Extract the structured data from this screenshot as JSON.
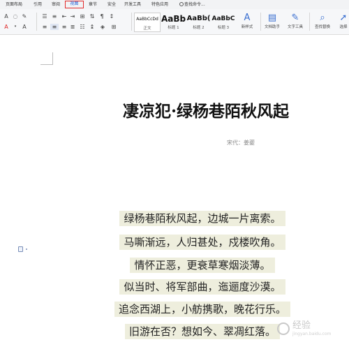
{
  "menu": {
    "tabs": [
      {
        "label": "页面布局"
      },
      {
        "label": "引用"
      },
      {
        "label": "审阅"
      },
      {
        "label": "视图"
      },
      {
        "label": "章节"
      },
      {
        "label": "安全"
      },
      {
        "label": "开发工具"
      },
      {
        "label": "特色应用"
      }
    ],
    "active_tab": "视图",
    "search_command": "查找命令..."
  },
  "ribbon": {
    "styles": [
      {
        "sample": "AaBbCcDd",
        "name": "正文"
      },
      {
        "sample": "AaBb",
        "name": "标题 1"
      },
      {
        "sample": "AaBb(",
        "name": "标题 2"
      },
      {
        "sample": "AaBbC",
        "name": "标题 3"
      }
    ],
    "buttons": {
      "new_style": "新样式",
      "doc_assistant": "文档助手",
      "text_tools": "文字工具",
      "find_replace": "查找替换",
      "select": "选择"
    },
    "accent_color": "#3a6fd0"
  },
  "document": {
    "title": "凄凉犯·绿杨巷陌秋风起",
    "author": "宋代：姜夔",
    "verses": [
      "绿杨巷陌秋风起，边城一片离索。",
      "马嘶渐远，人归甚处，戍楼吹角。",
      "情怀正恶，更衰草寒烟淡薄。",
      "似当时、将军部曲，迤逦度沙漠。",
      "追念西湖上，小舫携歌，晚花行乐。",
      "旧游在否？想如今、翠凋红落。"
    ],
    "highlight_color": "#eeeedd"
  },
  "watermark": {
    "text": "经验",
    "sub": "jingyan.baidu.com"
  }
}
